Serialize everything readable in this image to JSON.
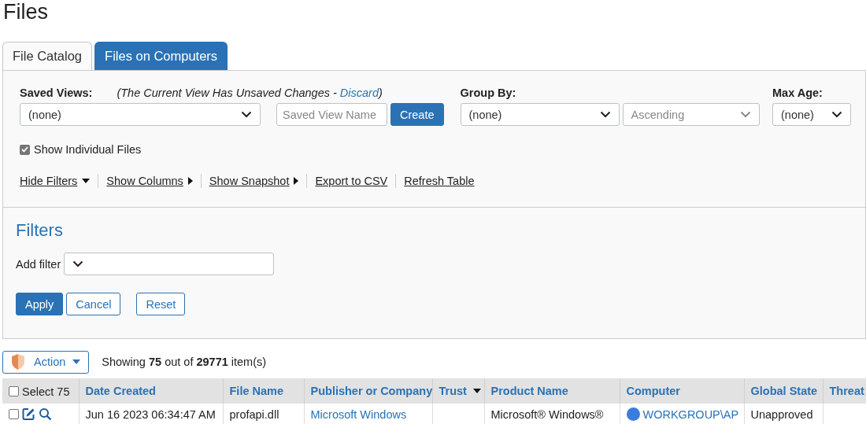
{
  "page_title": "Files",
  "tabs": [
    {
      "label": "File Catalog",
      "selected": false
    },
    {
      "label": "Files on Computers",
      "selected": true
    }
  ],
  "view_options": {
    "saved_views": {
      "label": "Saved Views:",
      "value": "(none)"
    },
    "unsaved_notice": {
      "text": "(The Current View Has Unsaved Changes - ",
      "link": "Discard",
      "end": ")"
    },
    "saved_view_name": {
      "placeholder": "Saved View Name"
    },
    "create_button": "Create",
    "group_by": {
      "label": "Group By:",
      "value": "(none)",
      "order": "Ascending",
      "order_disabled": true
    },
    "max_age": {
      "label": "Max Age:",
      "value": "(none)"
    },
    "show_individual_files": {
      "label": "Show Individual Files",
      "checked": true
    },
    "links": [
      {
        "label": "Hide Filters",
        "kind": "dropdown"
      },
      {
        "label": "Show Columns",
        "kind": "submenu"
      },
      {
        "label": "Show Snapshot",
        "kind": "submenu"
      },
      {
        "label": "Export to CSV",
        "kind": "action"
      },
      {
        "label": "Refresh Table",
        "kind": "action"
      }
    ]
  },
  "filters": {
    "title": "Filters",
    "add_filter_label": "Add filter",
    "buttons": [
      {
        "label": "Apply",
        "kind": "primary"
      },
      {
        "label": "Cancel",
        "kind": "secondary"
      },
      {
        "label": "Reset",
        "kind": "secondary"
      }
    ]
  },
  "toolbar": {
    "action_button": "Action",
    "summary": "Showing **75** out of **29771** item(s)"
  },
  "table": {
    "select_all": {
      "label": "Select 75",
      "checked": false
    },
    "columns": [
      {
        "label": "Date Created",
        "sorted": false
      },
      {
        "label": "File Name",
        "sorted": false
      },
      {
        "label": "Publisher or Company",
        "sorted": false
      },
      {
        "label": "Trust",
        "sorted": true
      },
      {
        "label": "Product Name",
        "sorted": false
      },
      {
        "label": "Computer",
        "sorted": false
      },
      {
        "label": "Global State",
        "sorted": false
      },
      {
        "label": "Threat",
        "sorted": false
      }
    ],
    "rows": [
      {
        "checked": false,
        "date_created": "Jun 16 2023 06:34:47 AM",
        "file_name": "profapi.dll",
        "publisher": "Microsoft Windows",
        "product_name": "Microsoft® Windows®",
        "computer": {
          "name": "WORKGROUP\\AP",
          "color": "#3b7ddd"
        },
        "global_state": "Unapproved"
      }
    ]
  }
}
